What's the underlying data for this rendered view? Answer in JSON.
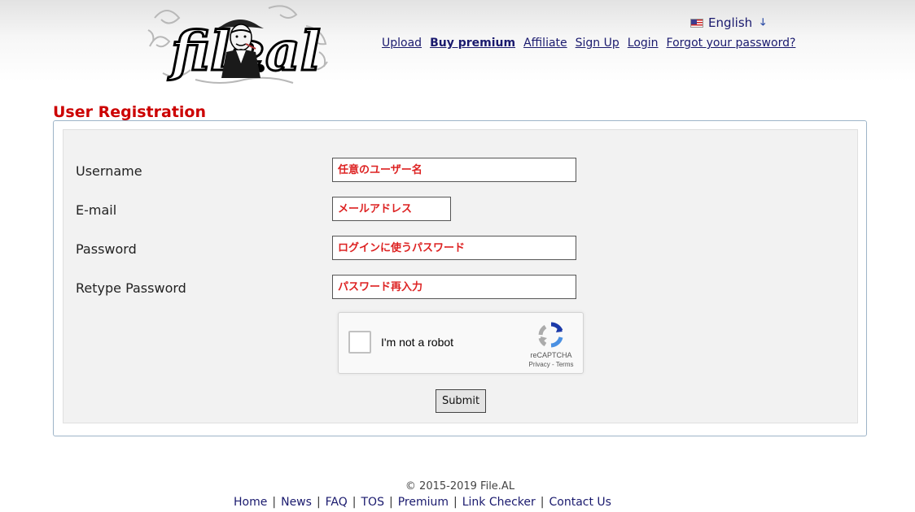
{
  "header": {
    "logo_text": "file.al",
    "language": {
      "label": "English",
      "icon": "us-flag-icon"
    },
    "nav": [
      {
        "label": "Upload",
        "bold": false
      },
      {
        "label": "Buy premium",
        "bold": true
      },
      {
        "label": "Affiliate",
        "bold": false
      },
      {
        "label": "Sign Up",
        "bold": false
      },
      {
        "label": "Login",
        "bold": false
      },
      {
        "label": "Forgot your password?",
        "bold": false
      }
    ]
  },
  "page": {
    "title": "User Registration"
  },
  "form": {
    "username": {
      "label": "Username",
      "placeholder": "任意のユーザー名"
    },
    "email": {
      "label": "E-mail",
      "placeholder": "メールアドレス"
    },
    "password": {
      "label": "Password",
      "placeholder": "ログインに使うパスワード"
    },
    "retype_password": {
      "label": "Retype Password",
      "placeholder": "パスワード再入力"
    },
    "recaptcha": {
      "label": "I'm not a robot",
      "brand": "reCAPTCHA",
      "privacy": "Privacy",
      "terms": "Terms"
    },
    "submit_label": "Submit"
  },
  "footer": {
    "copyright": "© 2015-2019 File.AL",
    "links": [
      "Home",
      "News",
      "FAQ",
      "TOS",
      "Premium",
      "Link Checker",
      "Contact Us"
    ]
  },
  "colors": {
    "title": "#cc0000",
    "link": "#1a1a6e",
    "placeholder": "#dd2222",
    "panel_border": "#9eb4c8",
    "panel_bg": "#f2f2f2"
  }
}
